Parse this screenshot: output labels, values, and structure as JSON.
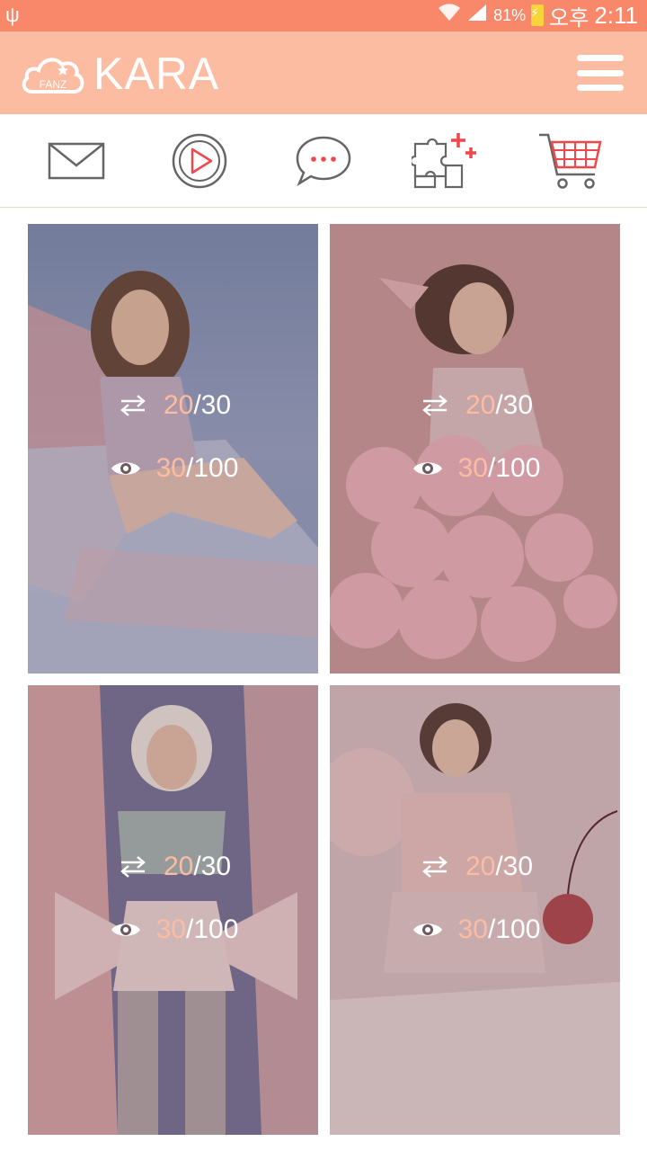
{
  "status_bar": {
    "battery": "81%",
    "ampm": "오후",
    "time": "2:11"
  },
  "header": {
    "logo_text": "FANZ",
    "title": "KARA"
  },
  "actions": [
    {
      "name": "mail"
    },
    {
      "name": "play"
    },
    {
      "name": "chat"
    },
    {
      "name": "puzzle-add"
    },
    {
      "name": "cart"
    }
  ],
  "cards": [
    {
      "swap_current": "20",
      "swap_total": "/30",
      "views_current": "30",
      "views_total": "/100"
    },
    {
      "swap_current": "20",
      "swap_total": "/30",
      "views_current": "30",
      "views_total": "/100"
    },
    {
      "swap_current": "20",
      "swap_total": "/30",
      "views_current": "30",
      "views_total": "/100"
    },
    {
      "swap_current": "20",
      "swap_total": "/30",
      "views_current": "30",
      "views_total": "/100"
    }
  ],
  "colors": {
    "status_bar": "#f9876a",
    "header": "#fcbca1",
    "accent": "#fcbca1",
    "icon_red": "#f0474a"
  }
}
